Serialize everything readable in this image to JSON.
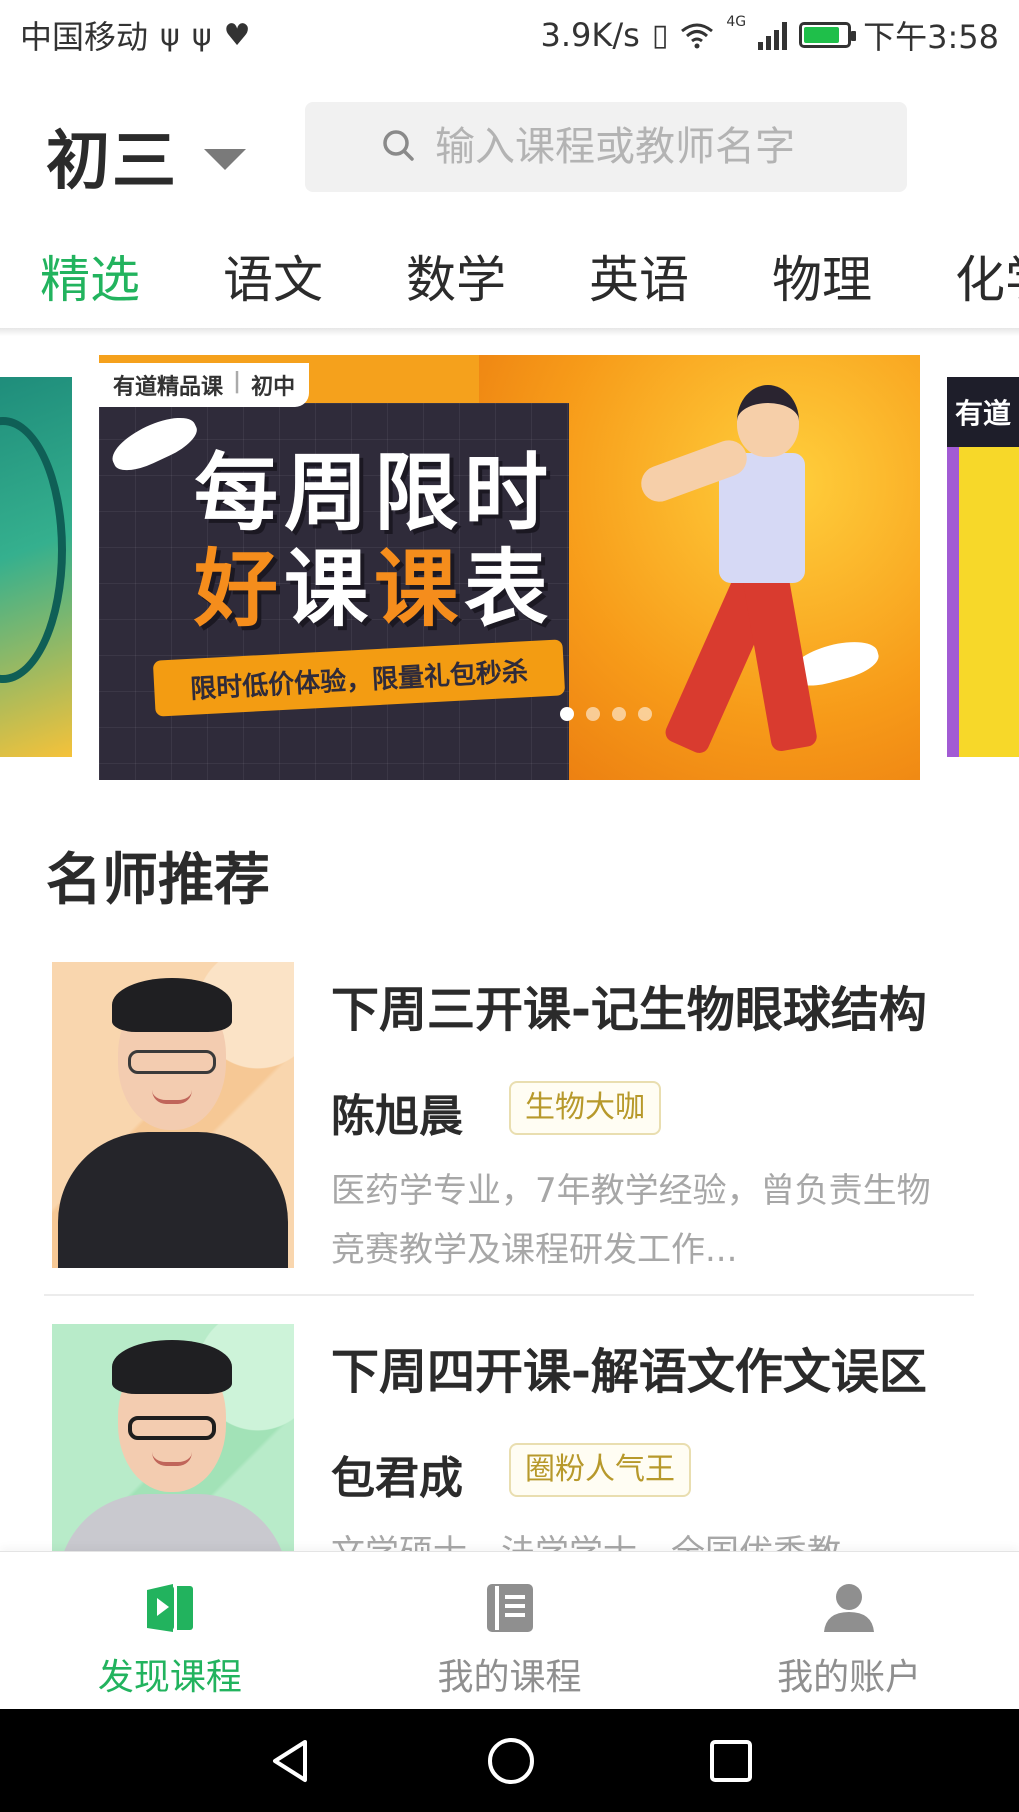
{
  "status_bar": {
    "carrier": "中国移动",
    "left_icons": [
      "usb-icon",
      "usb-icon",
      "heart-pulse-icon"
    ],
    "net_speed": "3.9K/s",
    "network_type": "4G",
    "time": "下午3:58",
    "battery_level": 0.8,
    "charging": true
  },
  "header": {
    "grade": "初三",
    "search_placeholder": "输入课程或教师名字"
  },
  "tabs": [
    {
      "label": "精选",
      "active": true
    },
    {
      "label": "语文",
      "active": false
    },
    {
      "label": "数学",
      "active": false
    },
    {
      "label": "英语",
      "active": false
    },
    {
      "label": "物理",
      "active": false
    },
    {
      "label": "化学",
      "active": false
    }
  ],
  "banner": {
    "brand_tag": "有道精品课",
    "level_tag": "初中",
    "title_line1": "每周限时",
    "title_line2_a": "好",
    "title_line2_b": "课",
    "title_line2_c": "课",
    "title_line2_d": "表",
    "subtitle": "限时低价体验，限量礼包秒杀",
    "dots_count": 4,
    "active_dot": 0,
    "peek_right_label": "有道"
  },
  "section": {
    "title": "名师推荐"
  },
  "teachers": [
    {
      "course": "下周三开课-记生物眼球结构",
      "name": "陈旭晨",
      "badge": "生物大咖",
      "desc": "医药学专业，7年教学经验，曾负责生物竞赛教学及课程研发工作..."
    },
    {
      "course": "下周四开课-解语文作文误区",
      "name": "包君成",
      "badge": "圈粉人气王",
      "desc": "文学硕士，法学学士，全国优秀教"
    }
  ],
  "bottom_nav": [
    {
      "label": "发现课程",
      "icon": "play-book-icon",
      "active": true
    },
    {
      "label": "我的课程",
      "icon": "book-list-icon",
      "active": false
    },
    {
      "label": "我的账户",
      "icon": "user-icon",
      "active": false
    }
  ],
  "colors": {
    "accent": "#22b35e",
    "badge_text": "#b7992b",
    "badge_border": "#e9deb0",
    "inactive": "#8f8f8f",
    "search_bg": "#f1f1f1"
  }
}
